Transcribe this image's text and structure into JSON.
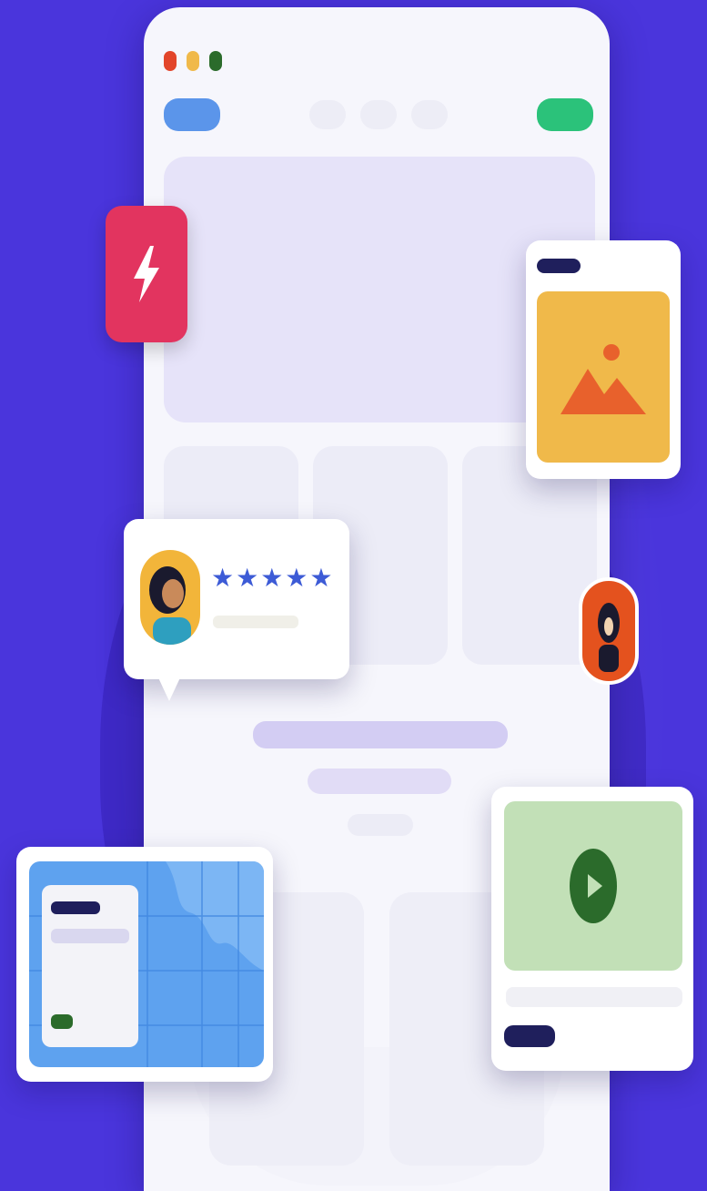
{
  "colors": {
    "background": "#4a35dc",
    "window_close": "#e2452a",
    "window_minimize": "#f0b94a",
    "window_maximize": "#2b6b2b",
    "primary_pill": "#5b95ea",
    "cta_pill": "#2bc27a",
    "lightning_badge": "#e2345f",
    "star": "#3d5bd6",
    "image_frame": "#f0b94a",
    "video_frame": "#c2e0b7",
    "play_button": "#2b6b2b",
    "map_water": "#5ea2ef"
  },
  "icons": {
    "lightning": "lightning-icon",
    "image": "image-icon",
    "play": "play-icon"
  },
  "review": {
    "rating": 5,
    "max_rating": 5,
    "stars": "★★★★★"
  }
}
